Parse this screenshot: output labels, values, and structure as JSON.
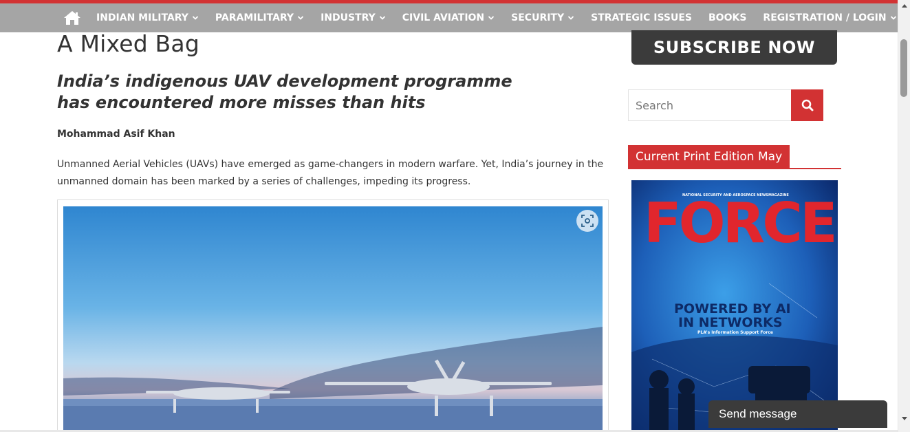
{
  "nav": {
    "home_icon": "home-icon",
    "items": [
      {
        "label": "INDIAN MILITARY",
        "has_dropdown": true
      },
      {
        "label": "PARAMILITARY",
        "has_dropdown": true
      },
      {
        "label": "INDUSTRY",
        "has_dropdown": true
      },
      {
        "label": "CIVIL AVIATION",
        "has_dropdown": true
      },
      {
        "label": "SECURITY",
        "has_dropdown": true
      },
      {
        "label": "STRATEGIC ISSUES",
        "has_dropdown": false
      },
      {
        "label": "BOOKS",
        "has_dropdown": false
      },
      {
        "label": "REGISTRATION / LOGIN",
        "has_dropdown": true
      }
    ],
    "shuffle_icon": "shuffle-icon"
  },
  "article": {
    "title": "A Mixed Bag",
    "subtitle": "India’s indigenous UAV development programme has encountered more misses than hits",
    "author": "Mohammad Asif Khan",
    "lead": "Unmanned Aerial Vehicles (UAVs) have emerged as game-changers in modern warfare. Yet, India’s journey in the unmanned domain has been marked by a series of challenges, impeding its progress.",
    "zoom_icon": "zoom-icon"
  },
  "sidebar": {
    "subscribe_label": "SUBSCRIBE NOW",
    "search_placeholder": "Search",
    "search_icon": "search-icon",
    "edition_heading": "Current Print Edition May",
    "cover": {
      "masthead_tagline": "NATIONAL SECURITY AND AEROSPACE NEWSMAGAZINE",
      "logo": "FORCE",
      "headline_line1": "POWERED BY AI",
      "headline_line2": "IN NETWORKS",
      "subhead": "PLA’s Information Support Force"
    }
  },
  "chat": {
    "label": "Send message"
  },
  "colors": {
    "accent": "#d23233",
    "nav_bg": "#a5a5a5",
    "dark_button": "#3b3b3b",
    "text": "#333333"
  }
}
